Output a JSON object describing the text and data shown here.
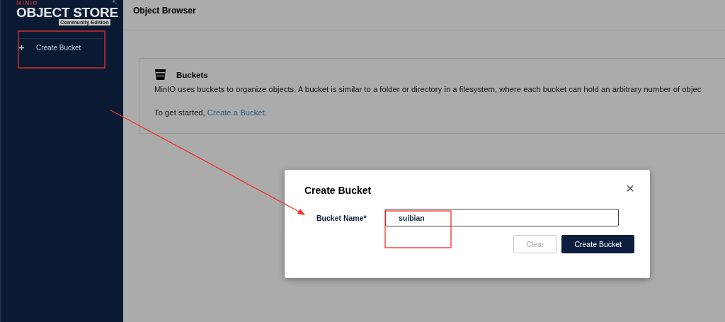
{
  "sidebar": {
    "brand": "MINIO",
    "product": "OBJECT STORE",
    "edition": "Community Edition",
    "items": [
      {
        "label": "Create Bucket"
      }
    ]
  },
  "header": {
    "title": "Object Browser"
  },
  "card": {
    "title": "Buckets",
    "body": "MinIO uses buckets to organize objects. A bucket is similar to a folder or directory in a filesystem, where each bucket can hold an arbitrary number of objec",
    "prompt": "To get started,",
    "link": "Create a Bucket."
  },
  "dialog": {
    "title": "Create Bucket",
    "close": "×",
    "field": {
      "label": "Bucket Name*",
      "value": "suibian"
    },
    "buttons": [
      {
        "label": "Clear",
        "kind": "secondary",
        "disabled": true
      },
      {
        "label": "Create Bucket",
        "kind": "primary",
        "disabled": false
      }
    ]
  }
}
